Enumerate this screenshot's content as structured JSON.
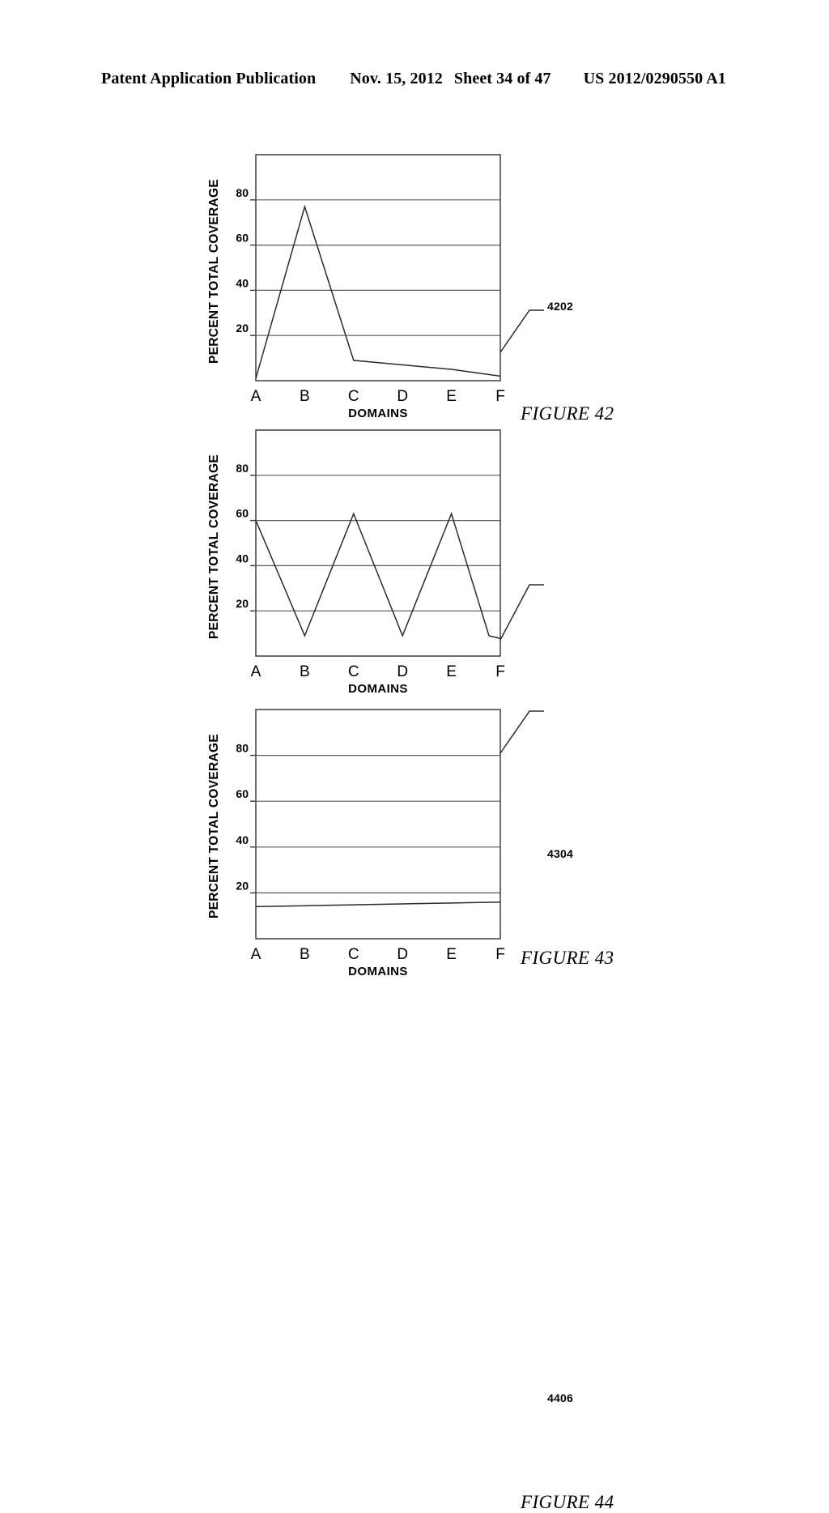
{
  "header": {
    "publication": "Patent Application Publication",
    "date": "Nov. 15, 2012",
    "sheet": "Sheet 34 of 47",
    "patent_number": "US 2012/0290550 A1"
  },
  "figures": [
    {
      "id": "figure-42",
      "caption": "FIGURE 42",
      "reference_numeral": "4202"
    },
    {
      "id": "figure-43",
      "caption": "FIGURE 43",
      "reference_numeral": "4304"
    },
    {
      "id": "figure-44",
      "caption": "FIGURE 44",
      "reference_numeral": "4406"
    }
  ],
  "axis_labels": {
    "y_title": "PERCENT TOTAL COVERAGE",
    "x_title": "DOMAINS",
    "y_ticks": [
      "80",
      "60",
      "40",
      "20"
    ],
    "x_ticks": [
      "A",
      "B",
      "C",
      "D",
      "E",
      "F"
    ]
  },
  "chart_data": [
    {
      "type": "line",
      "title": "FIGURE 42",
      "reference_numeral": "4202",
      "xlabel": "DOMAINS",
      "ylabel": "PERCENT TOTAL COVERAGE",
      "categories": [
        "A",
        "B",
        "C",
        "D",
        "E",
        "F"
      ],
      "x": [
        0,
        1,
        2,
        3,
        4,
        5
      ],
      "values": [
        1,
        77,
        9,
        7,
        5,
        2
      ],
      "ylim": [
        0,
        100
      ],
      "yticks": [
        20,
        40,
        60,
        80
      ],
      "grid": true,
      "legend": "none",
      "annotation": "Coverage is dominated by domain B (~77%); all other domains below 10%."
    },
    {
      "type": "line",
      "title": "FIGURE 43",
      "reference_numeral": "4304",
      "xlabel": "DOMAINS",
      "ylabel": "PERCENT TOTAL COVERAGE",
      "categories": [
        "A",
        "B",
        "C",
        "D",
        "E",
        "F"
      ],
      "x": [
        0,
        1,
        2,
        3,
        4,
        5
      ],
      "values": [
        60,
        9,
        63,
        9,
        63,
        9
      ],
      "ylim": [
        0,
        100
      ],
      "yticks": [
        20,
        40,
        60,
        80
      ],
      "grid": true,
      "legend": "none",
      "annotation": "Alternating zig-zag coverage oscillating between about 9% and 63%."
    },
    {
      "type": "line",
      "title": "FIGURE 44",
      "reference_numeral": "4406",
      "xlabel": "DOMAINS",
      "ylabel": "PERCENT TOTAL COVERAGE",
      "categories": [
        "A",
        "B",
        "C",
        "D",
        "E",
        "F"
      ],
      "x": [
        0,
        1,
        2,
        3,
        4,
        5
      ],
      "values": [
        14,
        14.4,
        14.8,
        15.2,
        15.6,
        16
      ],
      "ylim": [
        0,
        100
      ],
      "yticks": [
        20,
        40,
        60,
        80
      ],
      "grid": true,
      "legend": "none",
      "annotation": "Nearly uniform coverage across all domains, slightly rising from about 14% to 16%."
    }
  ]
}
